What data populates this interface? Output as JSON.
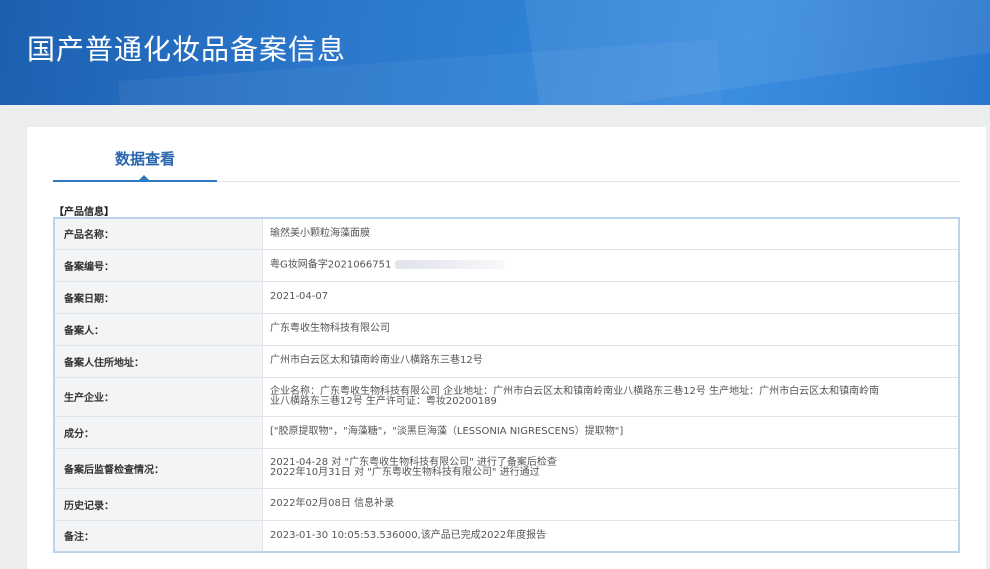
{
  "header": {
    "title": "国产普通化妆品备案信息"
  },
  "tab": {
    "label": "数据查看"
  },
  "section": {
    "label": "【产品信息】"
  },
  "rows": [
    {
      "label": "产品名称：",
      "lines": [
        "瑜然美小颗粒海藻面膜"
      ]
    },
    {
      "label": "备案编号：",
      "lines": [
        "粤G妆网备字2021066751"
      ]
    },
    {
      "label": "备案日期：",
      "lines": [
        "2021-04-07"
      ]
    },
    {
      "label": "备案人：",
      "lines": [
        "广东粤收生物科技有限公司"
      ]
    },
    {
      "label": "备案人住所地址：",
      "lines": [
        "广州市白云区太和镇南岭南业八横路东三巷12号"
      ]
    },
    {
      "label": "生产企业：",
      "lines": [
        "企业名称：广东粤收生物科技有限公司 企业地址：广州市白云区太和镇南岭南业八横路东三巷12号 生产地址：广州市白云区太和镇南岭南",
        "业八横路东三巷12号 生产许可证：粤妆20200189"
      ]
    },
    {
      "label": "成分：",
      "lines": [
        "[\"胶原提取物\"，\"海藻糖\"，\"淡黑巨海藻（LESSONIA NIGRESCENS）提取物\"]"
      ]
    },
    {
      "label": "备案后监督检查情况：",
      "lines": [
        "2021-04-28 对 \"广东粤收生物科技有限公司\" 进行了备案后检查",
        "2022年10月31日 对 \"广东粤收生物科技有限公司\" 进行通过"
      ]
    },
    {
      "label": "历史记录：",
      "lines": [
        "2022年02月08日 信息补录"
      ]
    },
    {
      "label": "备注：",
      "lines": [
        "2023-01-30 10:05:53.536000,该产品已完成2022年度报告"
      ]
    }
  ]
}
